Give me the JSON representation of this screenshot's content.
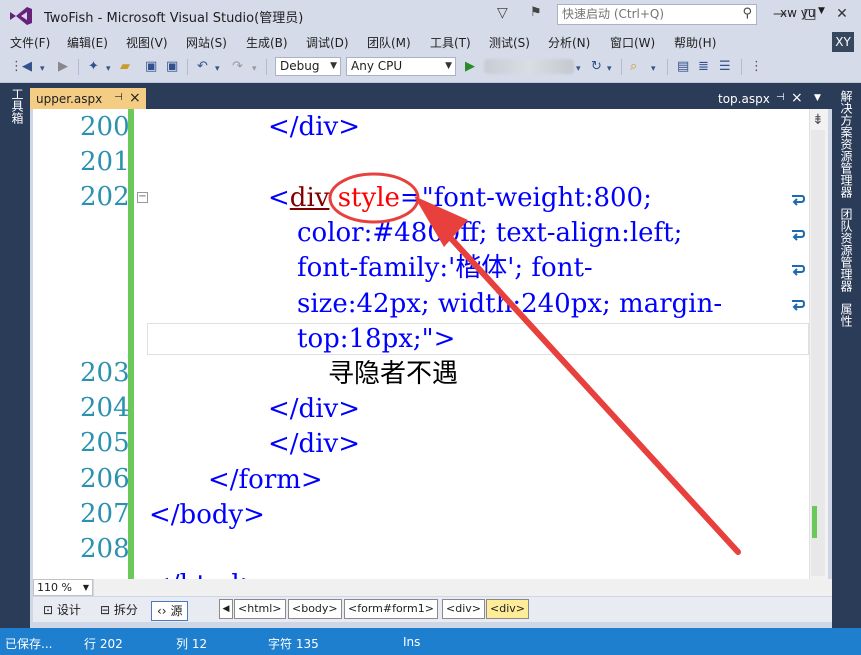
{
  "window": {
    "title": "TwoFish - Microsoft Visual Studio(管理员)",
    "quick_launch_placeholder": "快速启动 (Ctrl+Q)",
    "minimize": "—",
    "maximize": "□",
    "close": "✕"
  },
  "menu": {
    "items": [
      "文件(F)",
      "编辑(E)",
      "视图(V)",
      "网站(S)",
      "生成(B)",
      "调试(D)",
      "团队(M)",
      "工具(T)",
      "测试(S)",
      "分析(N)",
      "窗口(W)",
      "帮助(H)"
    ],
    "user_name": "xw yu",
    "avatar_initials": "XY"
  },
  "toolbar": {
    "config": "Debug",
    "platform": "Any CPU"
  },
  "side_panels": {
    "left": "工具箱",
    "right": [
      "解决方案资源管理器",
      "团队资源管理器",
      "属性"
    ]
  },
  "tabs": {
    "active": "upper.aspx",
    "other": "top.aspx"
  },
  "editor": {
    "line_numbers": [
      "200",
      "201",
      "202",
      "203",
      "204",
      "205",
      "206",
      "207",
      "208"
    ],
    "code": {
      "l200": "</div>",
      "l202_tag": "div",
      "l202_attr": "style",
      "l202_val1": "\"font-weight:800;",
      "l202_val2": "color:#4800ff; text-align:left;",
      "l202_val3": "font-family:'楷体'; font-",
      "l202_val4": "size:42px; width:240px; margin-",
      "l202_val5": "top:18px;\"",
      "l203": "寻隐者不遇",
      "l204": "</div>",
      "l205": "</div>",
      "l206": "</form>",
      "l207": "</body>",
      "l209": "</html>"
    },
    "zoom": "110 %"
  },
  "view_modes": {
    "design": "设计",
    "split": "拆分",
    "source": "源"
  },
  "breadcrumb": [
    "<html>",
    "<body>",
    "<form#form1>",
    "<div>",
    "<div>"
  ],
  "status": {
    "state": "已保存...",
    "line": "行 202",
    "col": "列 12",
    "char": "字符 135",
    "mode": "Ins"
  },
  "colors": {
    "statusbar": "#1e7fcf",
    "tab_active": "#f5cc84",
    "annotation": "#e8403c"
  }
}
